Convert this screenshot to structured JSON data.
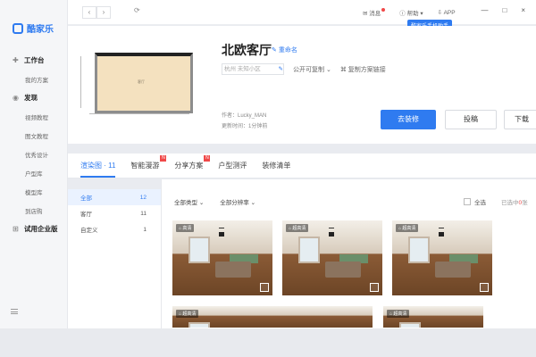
{
  "app": {
    "name": "酷家乐"
  },
  "sidebar": {
    "items": [
      {
        "label": "工作台",
        "icon": "desk-icon",
        "section": true
      },
      {
        "label": "我的方案",
        "icon": "",
        "section": false
      },
      {
        "label": "发现",
        "icon": "discover-icon",
        "section": true
      },
      {
        "label": "视频教程",
        "icon": "",
        "section": false
      },
      {
        "label": "图文教程",
        "icon": "",
        "section": false
      },
      {
        "label": "优秀设计",
        "icon": "",
        "section": false
      },
      {
        "label": "户型库",
        "icon": "",
        "section": false
      },
      {
        "label": "模型库",
        "icon": "",
        "section": false
      },
      {
        "label": "到店购",
        "icon": "",
        "section": false
      },
      {
        "label": "试用企业版",
        "icon": "trial-icon",
        "section": true
      }
    ]
  },
  "topbar": {
    "messages": "消息",
    "help": "帮助",
    "app": "APP",
    "tooltip": "酷家乐手机助手"
  },
  "plan": {
    "room_label": "客厅"
  },
  "project": {
    "title": "北欧客厅",
    "rename": "重命名",
    "city": "杭州 未知小区",
    "privacy": "公开可复制",
    "copy_link": "复制方案链接",
    "author": "作者：Lucky_MAN",
    "updated": "更新时间：1分钟前",
    "decorate_button": "去装修",
    "submit_button": "投稿",
    "download_button": "下载"
  },
  "tabs": [
    {
      "label": "渲染图 · 11",
      "active": true,
      "badge": ""
    },
    {
      "label": "智能漫游",
      "active": false,
      "badge": "N"
    },
    {
      "label": "分享方案",
      "active": false,
      "badge": "N"
    },
    {
      "label": "户型测评",
      "active": false,
      "badge": ""
    },
    {
      "label": "装修清单",
      "active": false,
      "badge": ""
    }
  ],
  "filters": [
    {
      "label": "全部",
      "count": "12",
      "active": true
    },
    {
      "label": "客厅",
      "count": "11",
      "active": false
    },
    {
      "label": "自定义",
      "count": "1",
      "active": false
    }
  ],
  "toolbar": {
    "type_filter": "全部类型",
    "resolution_filter": "全部分辨率",
    "select_all": "全选",
    "selected_prefix": "已选中",
    "selected_count": "0",
    "selected_suffix": "张"
  },
  "thumbnails": [
    {
      "label": "高清"
    },
    {
      "label": "超高清"
    },
    {
      "label": "超高清"
    },
    {
      "label": "超高清"
    },
    {
      "label": "超高清"
    }
  ]
}
